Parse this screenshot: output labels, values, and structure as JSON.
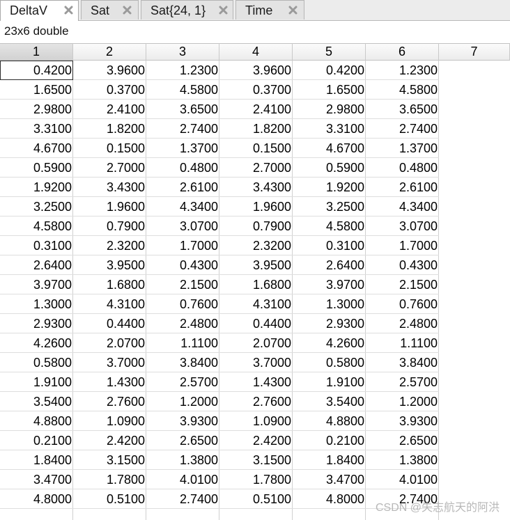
{
  "tabs": [
    {
      "label": "DeltaV",
      "active": true
    },
    {
      "label": "Sat",
      "active": false
    },
    {
      "label": "Sat{24, 1}",
      "active": false
    },
    {
      "label": "Time",
      "active": false
    }
  ],
  "variable_info": "23x6 double",
  "columns": [
    "1",
    "2",
    "3",
    "4",
    "5",
    "6",
    "7"
  ],
  "rows": [
    [
      "0.4200",
      "3.9600",
      "1.2300",
      "3.9600",
      "0.4200",
      "1.2300"
    ],
    [
      "1.6500",
      "0.3700",
      "4.5800",
      "0.3700",
      "1.6500",
      "4.5800"
    ],
    [
      "2.9800",
      "2.4100",
      "3.6500",
      "2.4100",
      "2.9800",
      "3.6500"
    ],
    [
      "3.3100",
      "1.8200",
      "2.7400",
      "1.8200",
      "3.3100",
      "2.7400"
    ],
    [
      "4.6700",
      "0.1500",
      "1.3700",
      "0.1500",
      "4.6700",
      "1.3700"
    ],
    [
      "0.5900",
      "2.7000",
      "0.4800",
      "2.7000",
      "0.5900",
      "0.4800"
    ],
    [
      "1.9200",
      "3.4300",
      "2.6100",
      "3.4300",
      "1.9200",
      "2.6100"
    ],
    [
      "3.2500",
      "1.9600",
      "4.3400",
      "1.9600",
      "3.2500",
      "4.3400"
    ],
    [
      "4.5800",
      "0.7900",
      "3.0700",
      "0.7900",
      "4.5800",
      "3.0700"
    ],
    [
      "0.3100",
      "2.3200",
      "1.7000",
      "2.3200",
      "0.3100",
      "1.7000"
    ],
    [
      "2.6400",
      "3.9500",
      "0.4300",
      "3.9500",
      "2.6400",
      "0.4300"
    ],
    [
      "3.9700",
      "1.6800",
      "2.1500",
      "1.6800",
      "3.9700",
      "2.1500"
    ],
    [
      "1.3000",
      "4.3100",
      "0.7600",
      "4.3100",
      "1.3000",
      "0.7600"
    ],
    [
      "2.9300",
      "0.4400",
      "2.4800",
      "0.4400",
      "2.9300",
      "2.4800"
    ],
    [
      "4.2600",
      "2.0700",
      "1.1100",
      "2.0700",
      "4.2600",
      "1.1100"
    ],
    [
      "0.5800",
      "3.7000",
      "3.8400",
      "3.7000",
      "0.5800",
      "3.8400"
    ],
    [
      "1.9100",
      "1.4300",
      "2.5700",
      "1.4300",
      "1.9100",
      "2.5700"
    ],
    [
      "3.5400",
      "2.7600",
      "1.2000",
      "2.7600",
      "3.5400",
      "1.2000"
    ],
    [
      "4.8800",
      "1.0900",
      "3.9300",
      "1.0900",
      "4.8800",
      "3.9300"
    ],
    [
      "0.2100",
      "2.4200",
      "2.6500",
      "2.4200",
      "0.2100",
      "2.6500"
    ],
    [
      "1.8400",
      "3.1500",
      "1.3800",
      "3.1500",
      "1.8400",
      "1.3800"
    ],
    [
      "3.4700",
      "1.7800",
      "4.0100",
      "1.7800",
      "3.4700",
      "4.0100"
    ],
    [
      "4.8000",
      "0.5100",
      "2.7400",
      "0.5100",
      "4.8000",
      "2.7400"
    ]
  ],
  "watermark": "CSDN @失志航天的阿洪"
}
